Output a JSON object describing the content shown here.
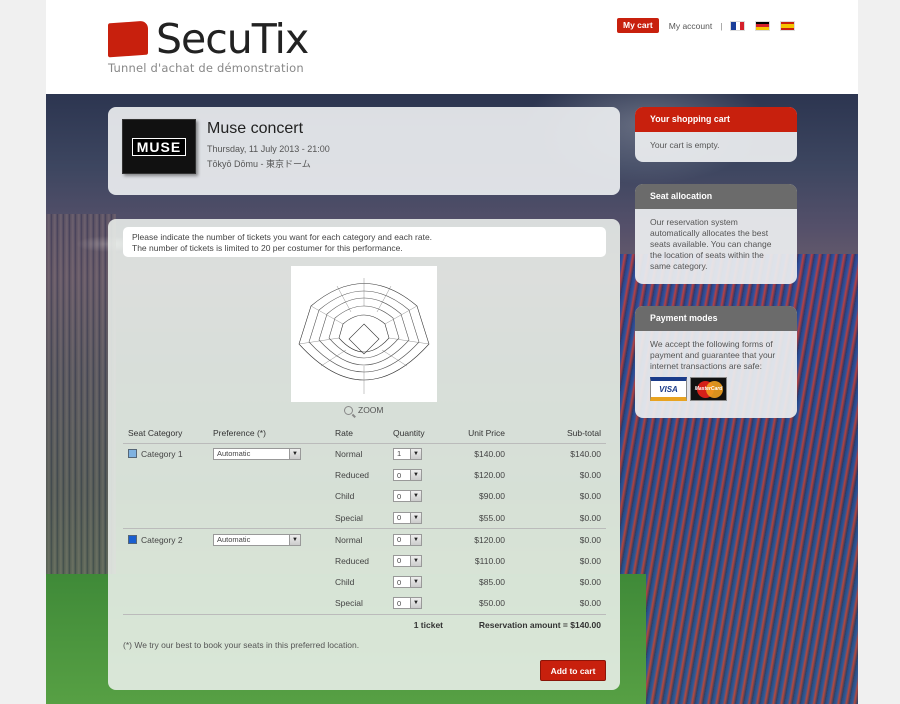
{
  "header": {
    "logo_text": "SecuTix",
    "tagline": "Tunnel d'achat de démonstration",
    "cart_button": "My cart",
    "account_link": "My account",
    "separator": "|",
    "languages": [
      "fr",
      "de",
      "es"
    ]
  },
  "event": {
    "thumb_label": "MUSE",
    "title": "Muse concert",
    "date": "Thursday, 11 July 2013 - 21:00",
    "venue": "Tōkyō Dōmu - 東京ドーム"
  },
  "tickets": {
    "info_line1": "Please indicate the number of tickets you want for each category and each rate.",
    "info_line2": "The number of tickets is limited to 20 per costumer for this performance.",
    "zoom_label": "ZOOM",
    "columns": [
      "Seat Category",
      "Preference (*)",
      "Rate",
      "Quantity",
      "Unit Price",
      "Sub-total"
    ],
    "categories": [
      {
        "name": "Category 1",
        "color": "#7fb2e0",
        "preference": "Automatic",
        "rates": [
          {
            "rate": "Normal",
            "qty": "1",
            "price": "$140.00",
            "subtotal": "$140.00"
          },
          {
            "rate": "Reduced",
            "qty": "0",
            "price": "$120.00",
            "subtotal": "$0.00"
          },
          {
            "rate": "Child",
            "qty": "0",
            "price": "$90.00",
            "subtotal": "$0.00"
          },
          {
            "rate": "Special",
            "qty": "0",
            "price": "$55.00",
            "subtotal": "$0.00"
          }
        ]
      },
      {
        "name": "Category 2",
        "color": "#1a5fd0",
        "preference": "Automatic",
        "rates": [
          {
            "rate": "Normal",
            "qty": "0",
            "price": "$120.00",
            "subtotal": "$0.00"
          },
          {
            "rate": "Reduced",
            "qty": "0",
            "price": "$110.00",
            "subtotal": "$0.00"
          },
          {
            "rate": "Child",
            "qty": "0",
            "price": "$85.00",
            "subtotal": "$0.00"
          },
          {
            "rate": "Special",
            "qty": "0",
            "price": "$50.00",
            "subtotal": "$0.00"
          }
        ]
      }
    ],
    "total_tickets": "1 ticket",
    "reservation_amount": "Reservation amount = $140.00",
    "footnote": "(*) We try our best to book your seats in this preferred location.",
    "add_to_cart": "Add to cart"
  },
  "sidebar": {
    "cart": {
      "title": "Your shopping cart",
      "body": "Your cart is empty."
    },
    "seat": {
      "title": "Seat allocation",
      "body": "Our reservation system automatically allocates the best seats available. You can change the location of seats within the same category."
    },
    "payment": {
      "title": "Payment modes",
      "body": "We accept the following forms of payment and guarantee that your internet transactions are safe:",
      "cards": [
        "VISA",
        "MasterCard"
      ]
    }
  },
  "colors": {
    "brand_red": "#c8200d",
    "panel_head_grey": "#6b6b6b"
  }
}
